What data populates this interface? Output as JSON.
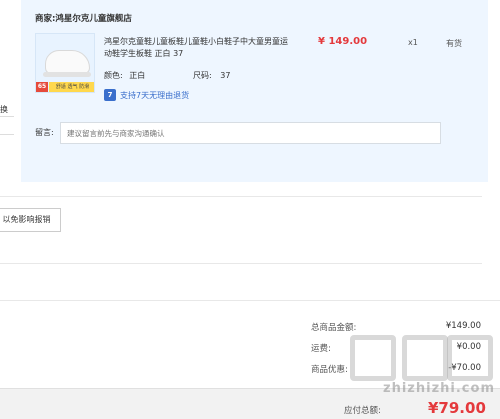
{
  "shop": {
    "label": "商家:",
    "name": "鸿星尔克儿童旗舰店"
  },
  "product": {
    "title": "鸿星尔克童鞋儿童板鞋儿童鞋小白鞋子中大童男童运动鞋学生板鞋 正白 37",
    "price": "¥ 149.00",
    "qty": "x1",
    "stock": "有货",
    "color_label": "颜色:",
    "color_value": "正白",
    "size_label": "尺码:",
    "size_value": "37",
    "service_icon": "7",
    "service_text": "支持7天无理由退货",
    "thumb_badge": "65",
    "thumb_strip": "舒适 透气 防滑"
  },
  "message": {
    "label": "留言:",
    "placeholder": "建议留言前先与商家沟通确认"
  },
  "left_fragment": "换",
  "invoice_button": "以免影响报销",
  "summary": {
    "goods_label": "总商品金额:",
    "goods_value": "¥149.00",
    "freight_label": "运费:",
    "freight_value": "¥0.00",
    "discount_label": "商品优惠:",
    "discount_value": "-¥70.00"
  },
  "payable": {
    "label": "应付总额:",
    "value": "¥79.00"
  },
  "watermark": {
    "text": "zhizhizhi.com"
  },
  "colors": {
    "accent_red": "#e4393c",
    "link_blue": "#3a6fcc",
    "panel_bg": "#eef6ff"
  }
}
